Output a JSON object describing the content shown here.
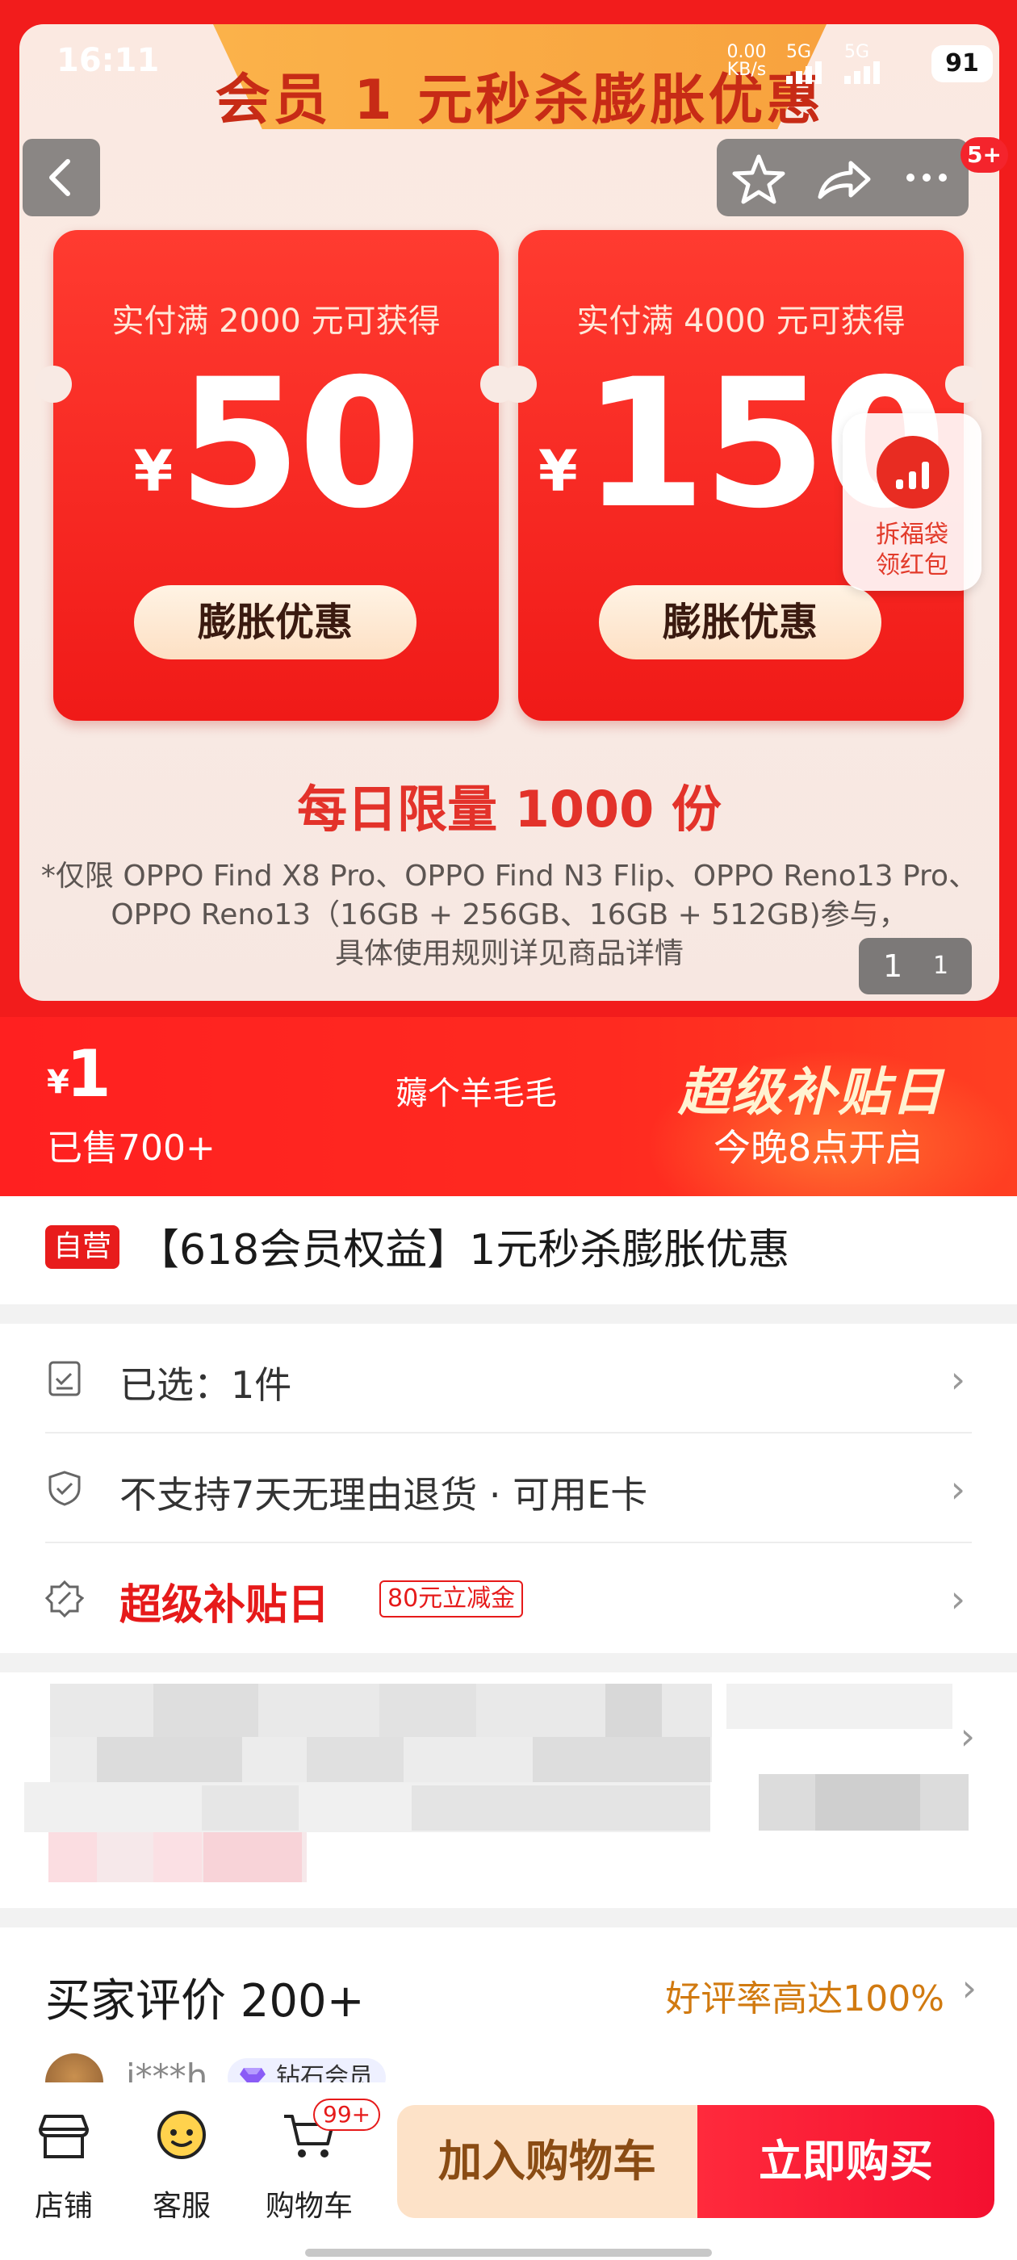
{
  "status_bar": {
    "time": "16:11",
    "net_speed": "0.00 KB/s",
    "signal_1": "5G",
    "signal_2": "5G",
    "battery": "91"
  },
  "nav": {
    "back_icon": "chevron-left-icon",
    "favorite_icon": "star-icon",
    "share_icon": "share-icon",
    "more_icon": "more-icon",
    "message_badge": "5+"
  },
  "hero": {
    "title": "会员 1 元秒杀膨胀优惠",
    "coupons": [
      {
        "condition": "实付满 2000 元可获得",
        "currency": "¥",
        "amount": "50",
        "button": "膨胀优惠"
      },
      {
        "condition": "实付满 4000 元可获得",
        "currency": "¥",
        "amount": "150",
        "button": "膨胀优惠"
      }
    ],
    "limit": "每日限量 1000 份",
    "note_line1": "*仅限 OPPO Find X8 Pro、OPPO Find N3 Flip、OPPO Reno13 Pro、",
    "note_line2": "OPPO Reno13（16GB + 256GB、16GB + 512GB)参与，",
    "note_line3": "具体使用规则详见商品详情",
    "pager_current": "1",
    "pager_total": "1"
  },
  "floating_promo": {
    "line1": "拆福袋",
    "line2": "领红包"
  },
  "price_bar": {
    "currency": "¥",
    "price": "1",
    "sold": "已售700+",
    "slogan": "薅个羊毛毛",
    "promo_title": "超级补贴日",
    "promo_sub": "今晚8点开启"
  },
  "product": {
    "tag": "自营",
    "title": "【618会员权益】1元秒杀膨胀优惠"
  },
  "options": [
    {
      "label": "已选：1件",
      "icon": "checklist-icon"
    },
    {
      "label": "不支持7天无理由退货  · 可用E卡",
      "icon": "shield-check-icon"
    },
    {
      "label": "超级补贴日",
      "icon": "discount-icon",
      "tag": "80元立减金"
    }
  ],
  "reviews": {
    "title": "买家评价 200+",
    "rate": "好评率高达100%",
    "user": "j***h",
    "badge": "钻石会员"
  },
  "bottom_bar": {
    "store": "店铺",
    "service": "客服",
    "cart": "购物车",
    "cart_count": "99+",
    "add_to_cart": "加入购物车",
    "buy_now": "立即购买"
  },
  "colors": {
    "brand_red": "#f21c1c",
    "promo_gold": "#fbb24a",
    "review_orange": "#d17a10",
    "cart_button_bg": "#fde2c8"
  }
}
